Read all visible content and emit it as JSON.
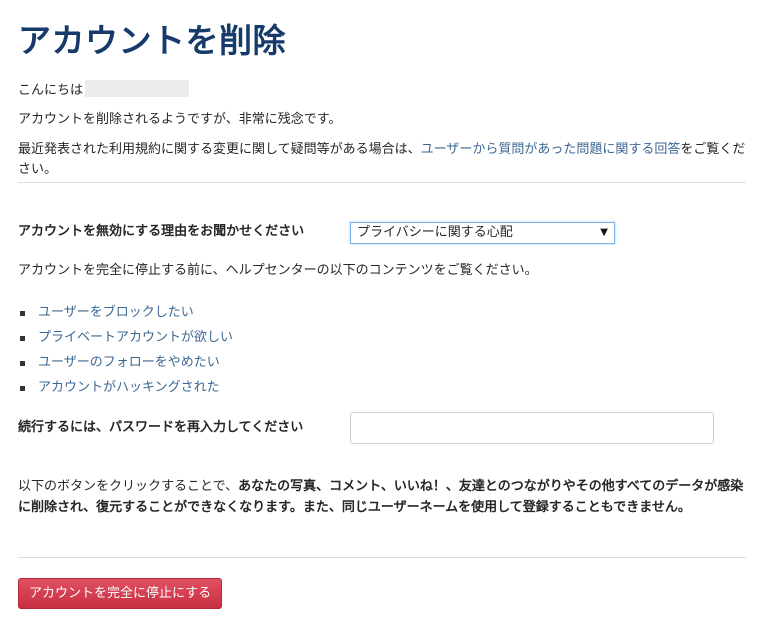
{
  "page_title": "アカウントを削除",
  "greeting": "こんにちは",
  "sorry_text": "アカウントを削除されるようですが、非常に残念です。",
  "terms": {
    "before": "最近発表された利用規約に関する変更に関して疑問等がある場合は、",
    "link": "ユーザーから質問があった問題に関する回答",
    "after": "をご覧ください。"
  },
  "reason": {
    "label": "アカウントを無効にする理由をお聞かせください",
    "selected": "プライバシーに関する心配"
  },
  "help_intro": "アカウントを完全に停止する前に、ヘルプセンターの以下のコンテンツをご覧ください。",
  "help_links": [
    "ユーザーをブロックしたい",
    "プライベートアカウントが欲しい",
    "ユーザーのフォローをやめたい",
    "アカウントがハッキングされた"
  ],
  "password": {
    "label": "続行するには、パスワードを再入力してください",
    "value": ""
  },
  "warning": {
    "plain": "以下のボタンをクリックすることで、",
    "bold": "あなたの写真、コメント、いいね！、友達とのつながりやその他すべてのデータが感染に削除され、復元することができなくなります。また、同じユーザーネームを使用して登録することもできません。"
  },
  "deactivate_button": "アカウントを完全に停止にする",
  "colors": {
    "title": "#163b6b",
    "link": "#3c6792",
    "button": "#d0384a"
  }
}
